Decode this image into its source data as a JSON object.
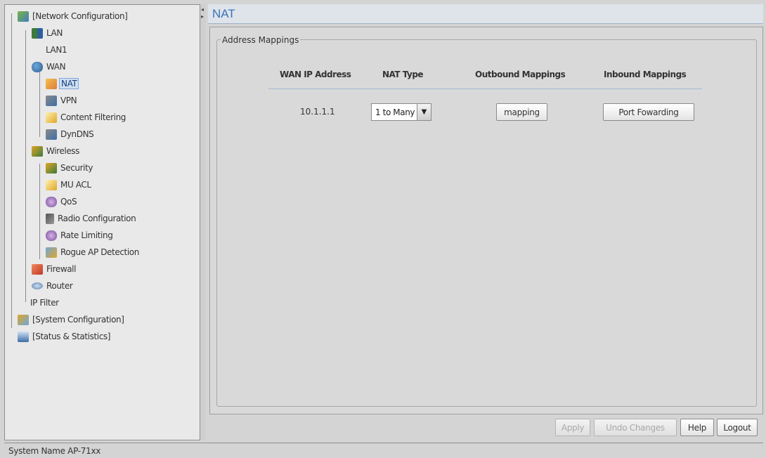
{
  "page": {
    "title": "NAT"
  },
  "tree": {
    "network_configuration": "[Network Configuration]",
    "lan": "LAN",
    "lan1": "LAN1",
    "wan": "WAN",
    "nat": "NAT",
    "vpn": "VPN",
    "content_filtering": "Content Filtering",
    "dyndns": "DynDNS",
    "wireless": "Wireless",
    "security": "Security",
    "mu_acl": "MU ACL",
    "qos": "QoS",
    "radio_configuration": "Radio Configuration",
    "rate_limiting": "Rate Limiting",
    "rogue_ap_detection": "Rogue AP Detection",
    "firewall": "Firewall",
    "router": "Router",
    "ip_filter": "IP Filter",
    "system_configuration": "[System Configuration]",
    "status_statistics": "[Status & Statistics]"
  },
  "address_mappings": {
    "legend": "Address Mappings",
    "columns": {
      "wan_ip": "WAN IP Address",
      "nat_type": "NAT Type",
      "outbound": "Outbound Mappings",
      "inbound": "Inbound Mappings"
    },
    "row": {
      "wan_ip": "10.1.1.1",
      "nat_type": "1 to Many",
      "outbound_button": "mapping",
      "inbound_button": "Port Fowarding"
    }
  },
  "actions": {
    "apply": "Apply",
    "undo": "Undo Changes",
    "help": "Help",
    "logout": "Logout"
  },
  "status_bar": {
    "text": "System Name AP-71xx"
  },
  "icons": {
    "network": "network-config-icon",
    "lan": "lan-icon",
    "wan": "wan-icon",
    "nat": "nat-icon",
    "vpn": "vpn-icon",
    "content_filtering": "filter-icon",
    "dyndns": "dyndns-icon",
    "wireless": "wireless-icon",
    "security": "security-icon",
    "mu_acl": "acl-icon",
    "qos": "qos-icon",
    "radio": "radio-icon",
    "rate": "rate-icon",
    "rogue": "rogue-icon",
    "firewall": "firewall-icon",
    "router": "router-icon",
    "system": "system-config-icon",
    "status": "status-icon"
  },
  "colors": {
    "title": "#3a72b8",
    "selection": "#cfe0f4"
  }
}
